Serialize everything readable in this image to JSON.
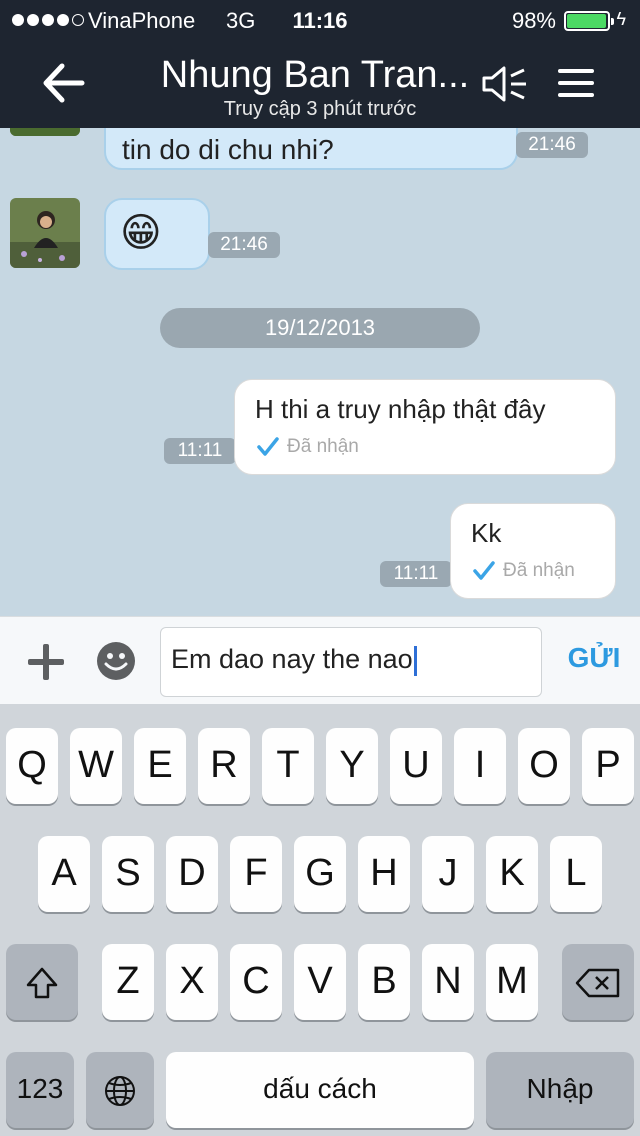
{
  "status_bar": {
    "carrier": "VinaPhone",
    "network": "3G",
    "time": "11:16",
    "battery": "98%",
    "battery_level": 0.98,
    "signal_bars_filled": 4,
    "signal_bars_total": 5
  },
  "header": {
    "title": "Nhung Ban Tran...",
    "subtitle": "Truy cập 3 phút trước",
    "back_icon": "back-arrow-icon",
    "speaker_icon": "speaker-icon",
    "menu_icon": "hamburger-menu-icon"
  },
  "messages": {
    "partial": {
      "text": "tin do di chu nhi?",
      "time": "21:46"
    },
    "emoji": {
      "emoji": "😁",
      "time": "21:46"
    },
    "date_separator": "19/12/2013",
    "out1": {
      "text": "H thi a truy nhập thật đây",
      "time": "11:11",
      "status": "Đã nhận"
    },
    "out2": {
      "text": "Kk",
      "time": "11:11",
      "status": "Đã nhận"
    }
  },
  "input": {
    "value": "Em dao nay the nao",
    "send_label": "GỬI",
    "plus_icon": "plus-icon",
    "emoji_icon": "emoji-icon"
  },
  "keyboard": {
    "row1": [
      "Q",
      "W",
      "E",
      "R",
      "T",
      "Y",
      "U",
      "I",
      "O",
      "P"
    ],
    "row2": [
      "A",
      "S",
      "D",
      "F",
      "G",
      "H",
      "J",
      "K",
      "L"
    ],
    "row3": [
      "Z",
      "X",
      "C",
      "V",
      "B",
      "N",
      "M"
    ],
    "numbers_label": "123",
    "space_label": "dấu cách",
    "return_label": "Nhập",
    "shift_icon": "shift-icon",
    "delete_icon": "backspace-icon",
    "globe_icon": "globe-icon"
  },
  "colors": {
    "header_bg": "#1e2530",
    "chat_bg": "#c6d7e2",
    "incoming_bubble": "#d3e9f9",
    "send_accent": "#2d9ae0",
    "check_blue": "#3ba4e6"
  }
}
